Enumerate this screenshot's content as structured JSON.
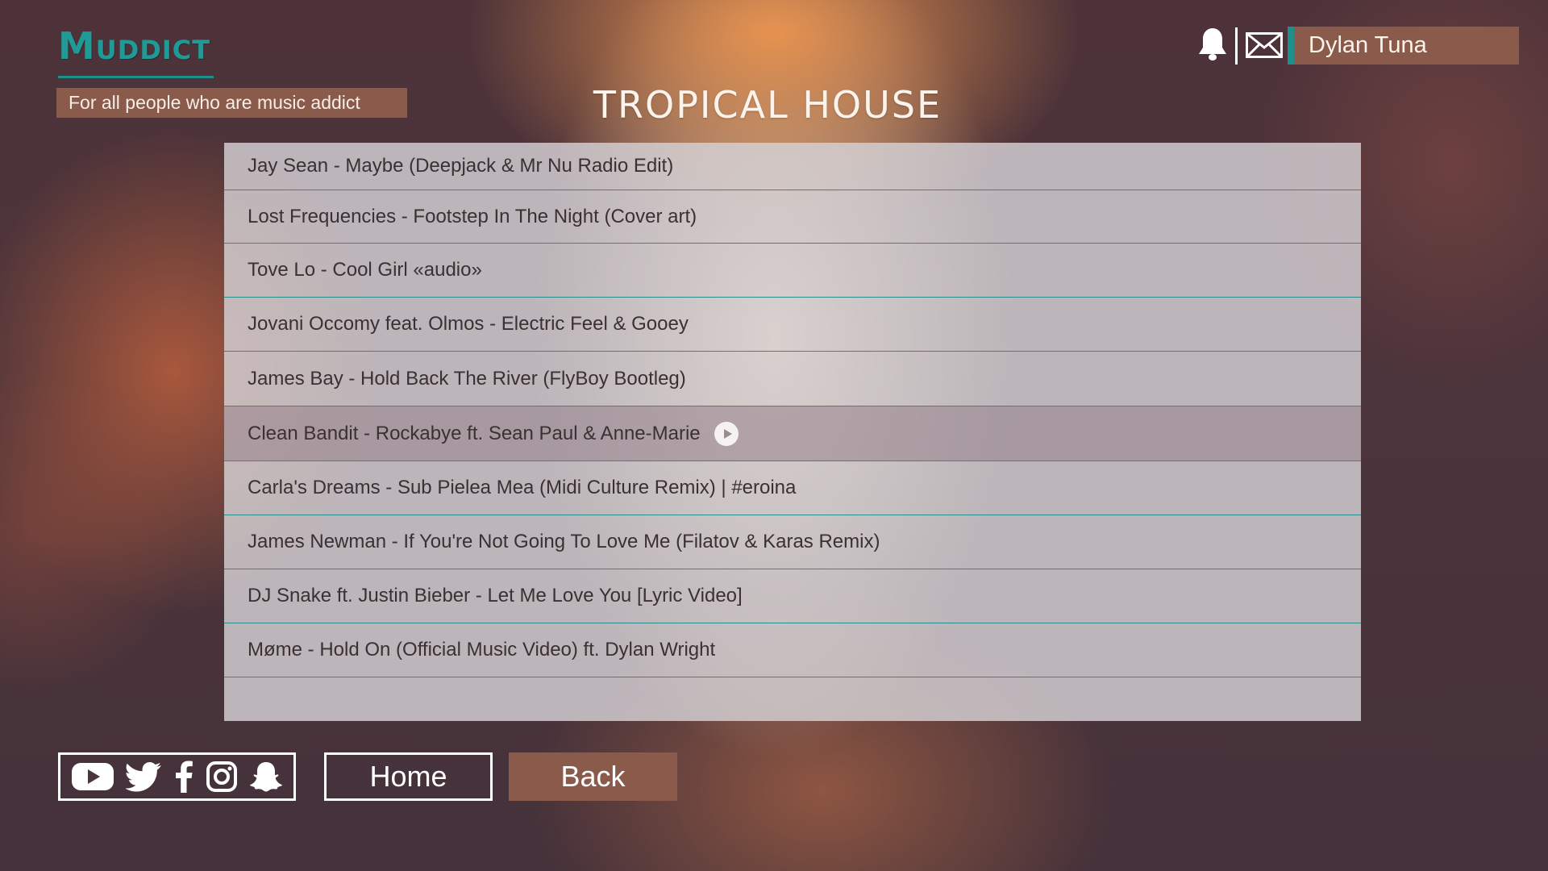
{
  "brand": {
    "logo_text": "Muddict",
    "tagline": "For all people who are music addict"
  },
  "header": {
    "page_title": "TROPICAL HOUSE",
    "user_name": "Dylan Tuna",
    "icons": [
      "bell-icon",
      "mail-icon"
    ]
  },
  "tracks": [
    {
      "title": "Jay Sean - Maybe (Deepjack & Mr Nu Radio Edit)"
    },
    {
      "title": "Lost Frequencies - Footstep In The Night (Cover art)"
    },
    {
      "title": "Tove Lo - Cool Girl «audio»"
    },
    {
      "title": "Jovani Occomy feat. Olmos - Electric Feel & Gooey"
    },
    {
      "title": "James Bay - Hold Back The River (FlyBoy Bootleg)"
    },
    {
      "title": "Clean Bandit - Rockabye ft. Sean Paul & Anne-Marie",
      "selected": true
    },
    {
      "title": "Carla's Dreams - Sub Pielea Mea (Midi Culture Remix) | #eroina"
    },
    {
      "title": "James Newman - If You're Not Going To Love Me (Filatov & Karas Remix)"
    },
    {
      "title": "DJ Snake ft. Justin Bieber - Let Me Love You [Lyric Video]"
    },
    {
      "title": "Møme - Hold On (Official Music Video) ft. Dylan Wright"
    }
  ],
  "footer": {
    "social_icons": [
      "youtube-icon",
      "twitter-icon",
      "facebook-icon",
      "instagram-icon",
      "snapchat-icon"
    ],
    "home_label": "Home",
    "back_label": "Back"
  },
  "colors": {
    "accent_teal": "#1f9a96",
    "brown_panel": "#8a5a4b",
    "background": "#4a333a"
  }
}
